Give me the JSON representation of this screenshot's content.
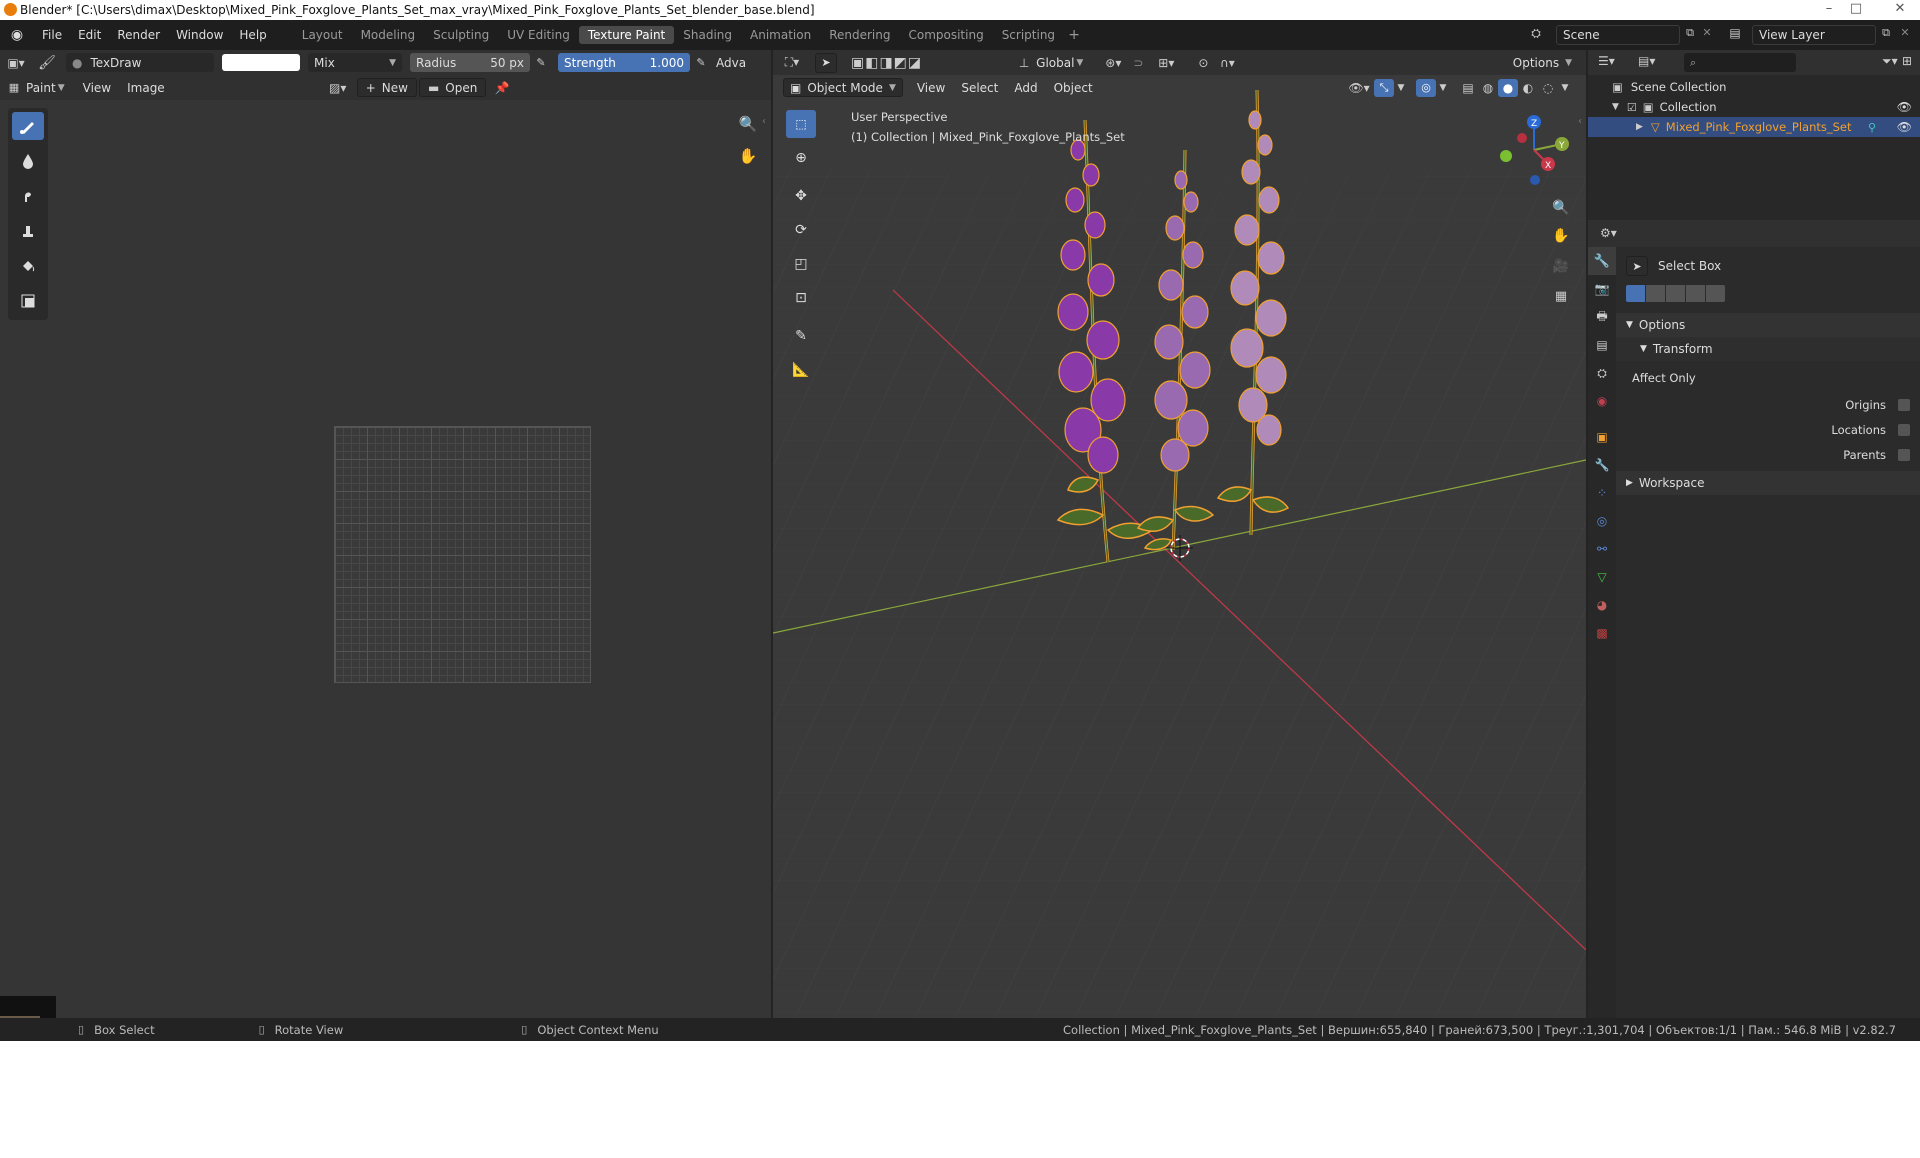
{
  "window": {
    "title": "Blender* [C:\\Users\\dimax\\Desktop\\Mixed_Pink_Foxglove_Plants_Set_max_vray\\Mixed_Pink_Foxglove_Plants_Set_blender_base.blend]"
  },
  "menus": [
    "File",
    "Edit",
    "Render",
    "Window",
    "Help"
  ],
  "workspaces": [
    "Layout",
    "Modeling",
    "Sculpting",
    "UV Editing",
    "Texture Paint",
    "Shading",
    "Animation",
    "Rendering",
    "Compositing",
    "Scripting"
  ],
  "active_workspace": "Texture Paint",
  "scene": {
    "name": "Scene",
    "view_layer": "View Layer"
  },
  "image_editor": {
    "brush_name": "TexDraw",
    "blend_mode": "Mix",
    "radius_label": "Radius",
    "radius_value": "50 px",
    "strength_label": "Strength",
    "strength_value": "1.000",
    "adv_label": "Adva",
    "mode": "Paint",
    "menu_view": "View",
    "menu_image": "Image",
    "new_label": "New",
    "open_label": "Open"
  },
  "viewport": {
    "orientation": "Global",
    "options_label": "Options",
    "mode": "Object Mode",
    "menus": [
      "View",
      "Select",
      "Add",
      "Object"
    ],
    "perspective_label": "User Perspective",
    "collection_label": "(1) Collection | Mixed_Pink_Foxglove_Plants_Set",
    "gizmo": {
      "x": "X",
      "y": "Y",
      "z": "Z"
    }
  },
  "outliner": {
    "root": "Scene Collection",
    "collection": "Collection",
    "object": "Mixed_Pink_Foxglove_Plants_Set"
  },
  "properties": {
    "tool_name": "Select Box",
    "options_label": "Options",
    "transform_label": "Transform",
    "affect_only_label": "Affect Only",
    "origins_label": "Origins",
    "locations_label": "Locations",
    "parents_label": "Parents",
    "workspace_label": "Workspace"
  },
  "statusbar": {
    "box_select": "Box Select",
    "rotate_view": "Rotate View",
    "context_menu": "Object Context Menu",
    "stats": "Collection | Mixed_Pink_Foxglove_Plants_Set | Вершин:655,840 | Граней:673,500 | Треуг.:1,301,704 | Объектов:1/1 | Пам.: 546.8 MiB | v2.82.7"
  },
  "colors": {
    "accent": "#4772b3",
    "selected_orange": "#f0a030",
    "x_axis": "#c8384a",
    "y_axis": "#8aa83a"
  }
}
